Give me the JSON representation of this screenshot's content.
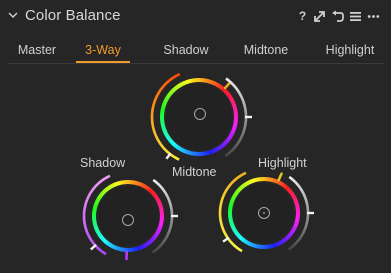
{
  "panel": {
    "title": "Color Balance"
  },
  "header_icons": [
    {
      "name": "help-icon",
      "glyph": "?"
    },
    {
      "name": "expand-icon"
    },
    {
      "name": "reset-icon"
    },
    {
      "name": "menu-icon"
    },
    {
      "name": "more-icon"
    }
  ],
  "tabs": [
    {
      "label": "Master",
      "active": false
    },
    {
      "label": "3-Way",
      "active": true
    },
    {
      "label": "Shadow",
      "active": false
    },
    {
      "label": "Midtone",
      "active": false
    },
    {
      "label": "Highlight",
      "active": false
    }
  ],
  "wheels": {
    "midtone_label": "Midtone",
    "shadow_label": "Shadow",
    "highlight_label": "Highlight"
  },
  "colors": {
    "accent": "#f39a2c",
    "background": "#262626",
    "text": "#d6d6d6"
  }
}
